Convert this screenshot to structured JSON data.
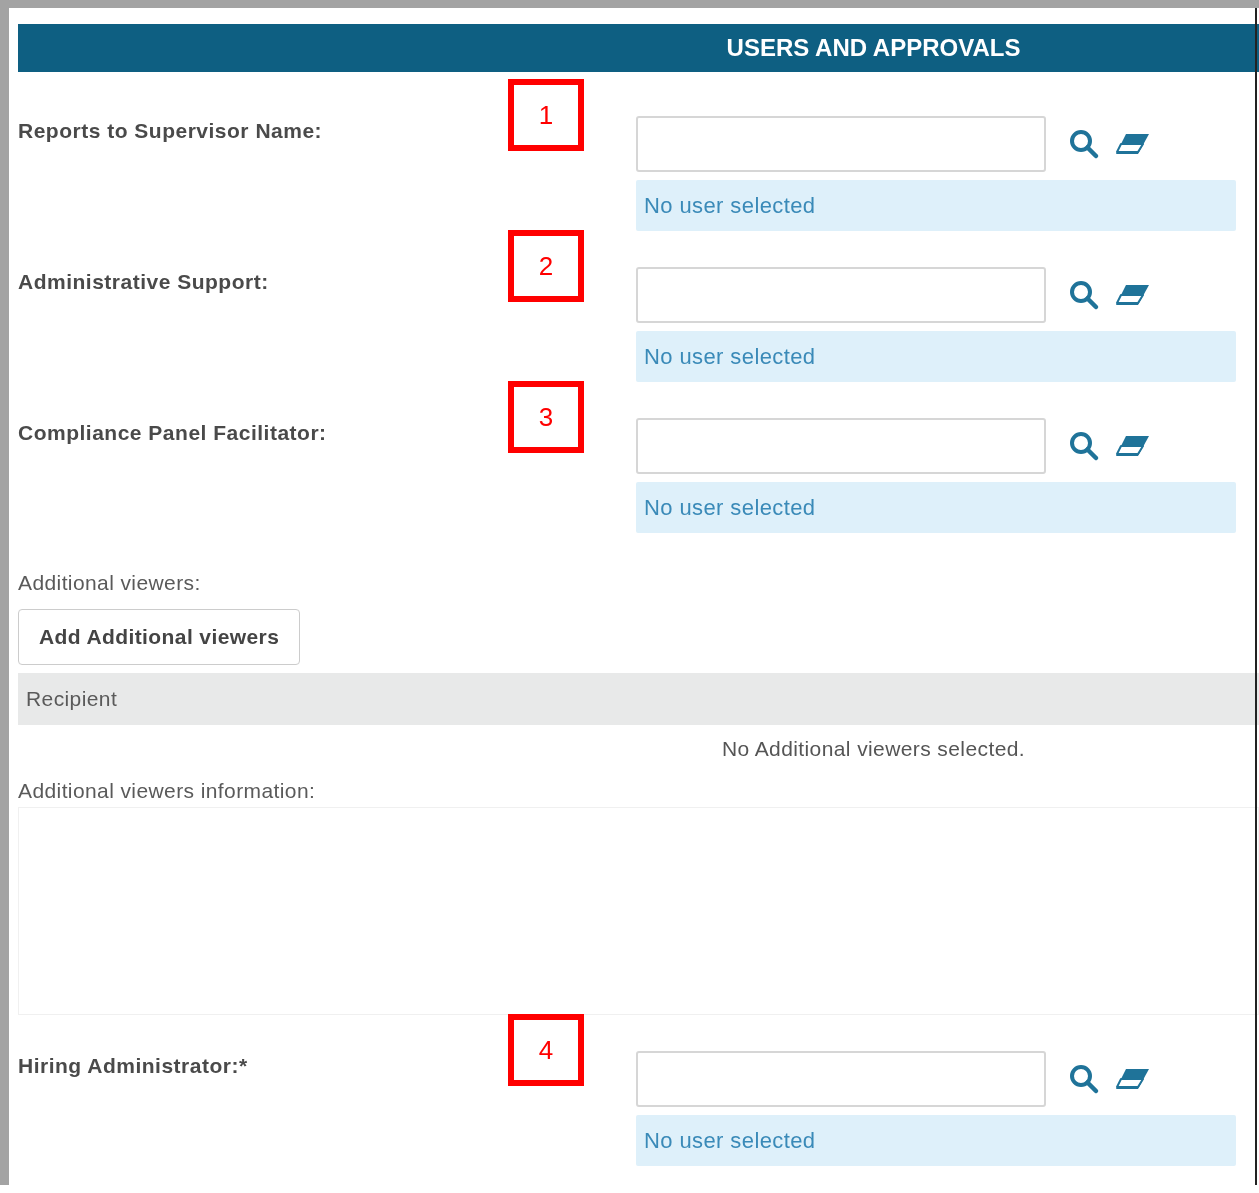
{
  "header": {
    "title": "USERS AND APPROVALS"
  },
  "user_fields": [
    {
      "label": "Reports to Supervisor Name:",
      "marker": "1",
      "status": "No user selected"
    },
    {
      "label": "Administrative Support:",
      "marker": "2",
      "status": "No user selected"
    },
    {
      "label": "Compliance Panel Facilitator:",
      "marker": "3",
      "status": "No user selected"
    }
  ],
  "additional_viewers": {
    "label": "Additional viewers:",
    "button": "Add Additional viewers",
    "table": {
      "columns": [
        "Recipient"
      ],
      "empty_message": "No Additional viewers selected."
    },
    "info_label": "Additional viewers information:"
  },
  "final_fields": [
    {
      "label": "Hiring Administrator:*",
      "marker": "4",
      "status": "No user selected"
    }
  ]
}
